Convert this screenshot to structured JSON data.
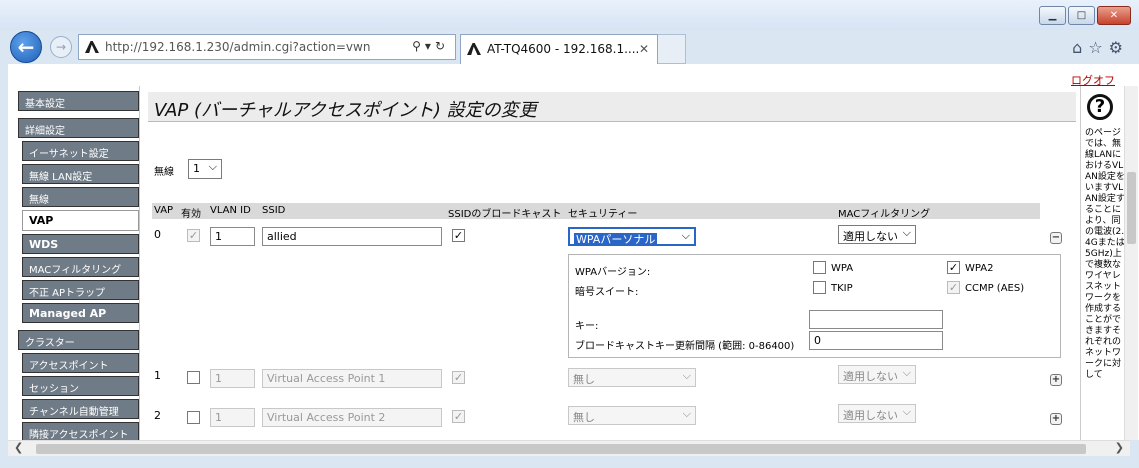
{
  "browser": {
    "url": "http://192.168.1.230/admin.cgi?action=vwn",
    "tab_title": "AT-TQ4600 - 192.168.1....",
    "window_buttons": [
      "minimize",
      "maximize",
      "close"
    ]
  },
  "page": {
    "logout": "ログオフ",
    "title": "VAP (バーチャルアクセスポイント) 設定の変更"
  },
  "sidebar": {
    "items": [
      {
        "label": "基本設定"
      },
      {
        "label": "詳細設定"
      },
      {
        "label": "イーサネット設定"
      },
      {
        "label": "無線 LAN設定"
      },
      {
        "label": "無線"
      },
      {
        "label": "VAP"
      },
      {
        "label": "WDS"
      },
      {
        "label": "MACフィルタリング"
      },
      {
        "label": "不正 APトラップ"
      },
      {
        "label": "Managed AP"
      },
      {
        "label": "クラスター"
      },
      {
        "label": "アクセスポイント"
      },
      {
        "label": "セッション"
      },
      {
        "label": "チャンネル自動管理"
      },
      {
        "label": "隣接アクセスポイント"
      }
    ]
  },
  "radio": {
    "label": "無線",
    "value": "1"
  },
  "table": {
    "headers": [
      "VAP",
      "有効",
      "VLAN ID",
      "SSID",
      "SSIDのブロードキャスト",
      "セキュリティー",
      "MACフィルタリング"
    ],
    "rows": [
      {
        "vap": "0",
        "vlan": "1",
        "ssid": "allied",
        "security": "WPAパーソナル",
        "mac": "適用しない"
      },
      {
        "vap": "1",
        "vlan": "1",
        "ssid": "Virtual Access Point 1",
        "security": "無し",
        "mac": "適用しない"
      },
      {
        "vap": "2",
        "vlan": "1",
        "ssid": "Virtual Access Point 2",
        "security": "無し",
        "mac": "適用しない"
      }
    ]
  },
  "wpa": {
    "version_label": "WPAバージョン:",
    "wpa": "WPA",
    "wpa2": "WPA2",
    "cipher_label": "暗号スイート:",
    "tkip": "TKIP",
    "ccmp": "CCMP (AES)",
    "key_label": "キー:",
    "key_value": "",
    "rekey_label": "ブロードキャストキー更新間隔 (範囲: 0-86400)",
    "rekey_value": "0"
  },
  "help": {
    "text": "のページでは、無線LANにおけるVLAN設定をいますVLAN設定することにより、同の電波(2.4Gまたは5GHz)上で複数なワイヤレスネットワークを作成することができますそれぞれのネットワークに対して"
  },
  "icons": [
    "back-icon",
    "forward-icon",
    "search-icon",
    "refresh-icon",
    "home-icon",
    "star-icon",
    "gear-icon",
    "help-icon"
  ]
}
